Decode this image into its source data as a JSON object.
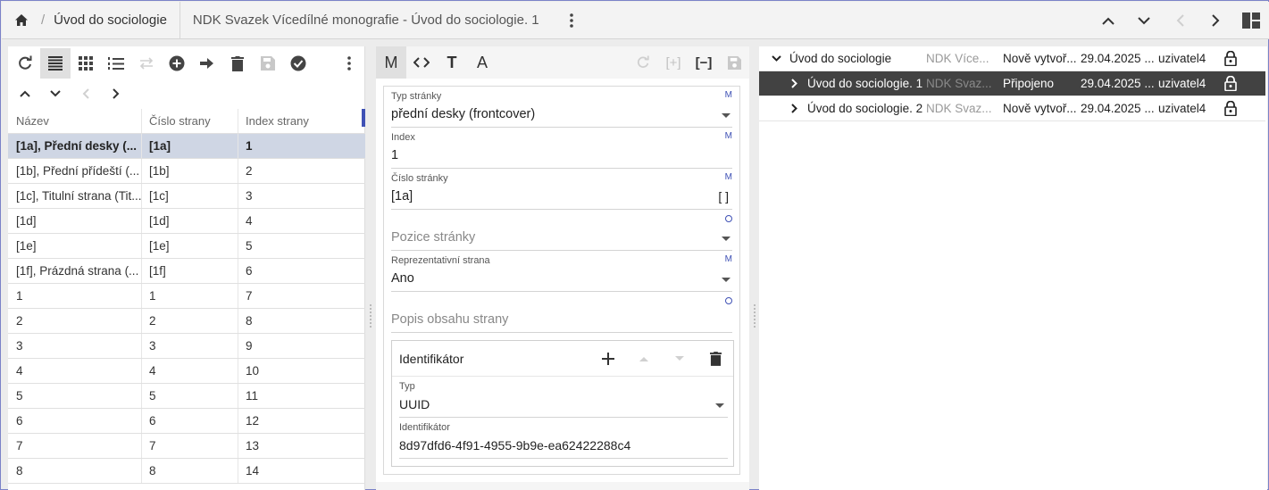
{
  "header": {
    "breadcrumb": "Úvod do sociologie",
    "separator": "/",
    "title": "NDK Svazek Vícedílné monografie - Úvod do sociologie. 1"
  },
  "table": {
    "headers": [
      "Název",
      "Číslo strany",
      "Index strany"
    ],
    "rows": [
      [
        "[1a], Přední desky (...",
        "[1a]",
        "1"
      ],
      [
        "[1b], Přední přídeští (...",
        "[1b]",
        "2"
      ],
      [
        "[1c], Titulní strana (Tit...",
        "[1c]",
        "3"
      ],
      [
        "[1d]",
        "[1d]",
        "4"
      ],
      [
        "[1e]",
        "[1e]",
        "5"
      ],
      [
        "[1f], Prázdná strana (...",
        "[1f]",
        "6"
      ],
      [
        "1",
        "1",
        "7"
      ],
      [
        "2",
        "2",
        "8"
      ],
      [
        "3",
        "3",
        "9"
      ],
      [
        "4",
        "4",
        "10"
      ],
      [
        "5",
        "5",
        "11"
      ],
      [
        "6",
        "6",
        "12"
      ],
      [
        "7",
        "7",
        "13"
      ],
      [
        "8",
        "8",
        "14"
      ]
    ]
  },
  "editor": {
    "tabs": [
      "M",
      "<>",
      "T",
      "A"
    ],
    "add_label": "[+]",
    "remove_label": "[−]",
    "fields": {
      "typ_label": "Typ stránky",
      "typ_value": "přední desky (frontcover)",
      "typ_badge": "M",
      "index_label": "Index",
      "index_value": "1",
      "index_badge": "M",
      "cislo_label": "Číslo stránky",
      "cislo_value": "[1a]",
      "cislo_badge": "M",
      "cislo_brackets": "[ ]",
      "pozice_placeholder": "Pozice stránky",
      "repr_label": "Reprezentativní strana",
      "repr_value": "Ano",
      "repr_badge": "M",
      "popis_placeholder": "Popis obsahu strany"
    },
    "identifier": {
      "title": "Identifikátor",
      "typ_label": "Typ",
      "typ_value": "UUID",
      "id_label": "Identifikátor",
      "id_value": "8d97dfd6-4f91-4955-9b9e-ea62422288c4"
    }
  },
  "tree": [
    {
      "name": "Úvod do sociologie",
      "model": "NDK Více...",
      "state": "Nově vytvoř...",
      "date": "29.04.2025 ...",
      "user": "uzivatel4"
    },
    {
      "name": "Úvod do sociologie. 1",
      "model": "NDK Svaz...",
      "state": "Připojeno",
      "date": "29.04.2025 ...",
      "user": "uzivatel4"
    },
    {
      "name": "Úvod do sociologie. 2",
      "model": "NDK Svaz...",
      "state": "Nově vytvoř...",
      "date": "29.04.2025 ...",
      "user": "uzivatel4"
    }
  ]
}
